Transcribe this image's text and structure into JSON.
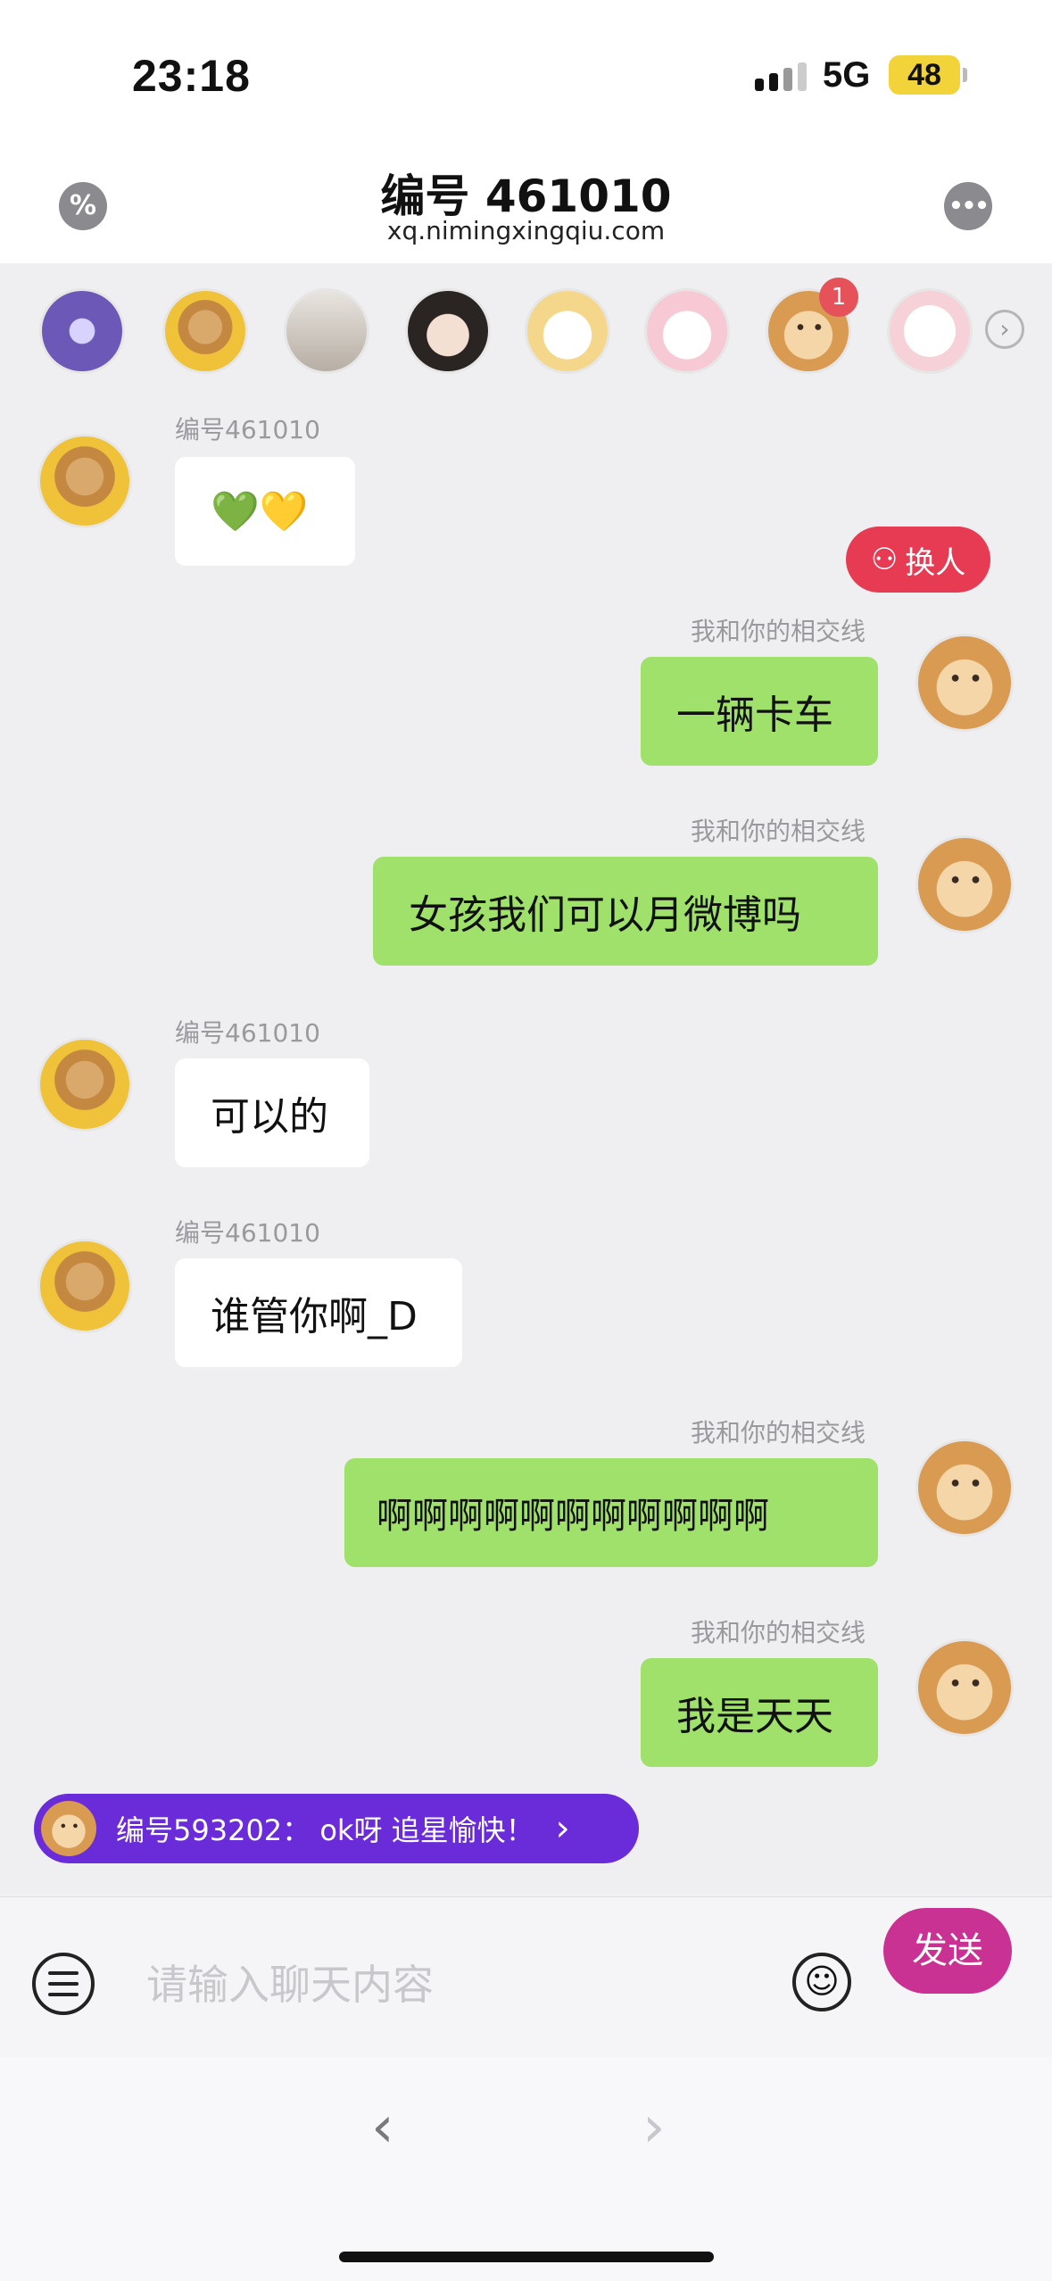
{
  "status": {
    "time": "23:18",
    "network": "5G",
    "battery": "48"
  },
  "header": {
    "title": "编号 461010",
    "subtitle": "xq.nimingxingqiu.com",
    "left_icon": "percent-icon",
    "right_icon": "more-dots-icon"
  },
  "avatar_bar": {
    "badge_count": "1"
  },
  "swap_button": {
    "label": "换人"
  },
  "messages": [
    {
      "sender": "编号461010",
      "text": "💚💛"
    },
    {
      "sender": "我和你的相交线",
      "text": "一辆卡车"
    },
    {
      "sender": "我和你的相交线",
      "text": "女孩我们可以月微博吗"
    },
    {
      "sender": "编号461010",
      "text": "可以的"
    },
    {
      "sender": "编号461010",
      "text": "谁管你啊_D"
    },
    {
      "sender": "我和你的相交线",
      "text": "啊啊啊啊啊啊啊啊啊啊啊"
    },
    {
      "sender": "我和你的相交线",
      "text": "我是天天"
    }
  ],
  "notification": {
    "text": "编号593202： ok呀 追星愉快！"
  },
  "input_bar": {
    "placeholder": "请输入聊天内容",
    "send_label": "发送"
  },
  "colors": {
    "accent": "#c93192",
    "out_bubble": "#9fe16b",
    "notif": "#6a2bd9",
    "swap": "#e63b53"
  }
}
